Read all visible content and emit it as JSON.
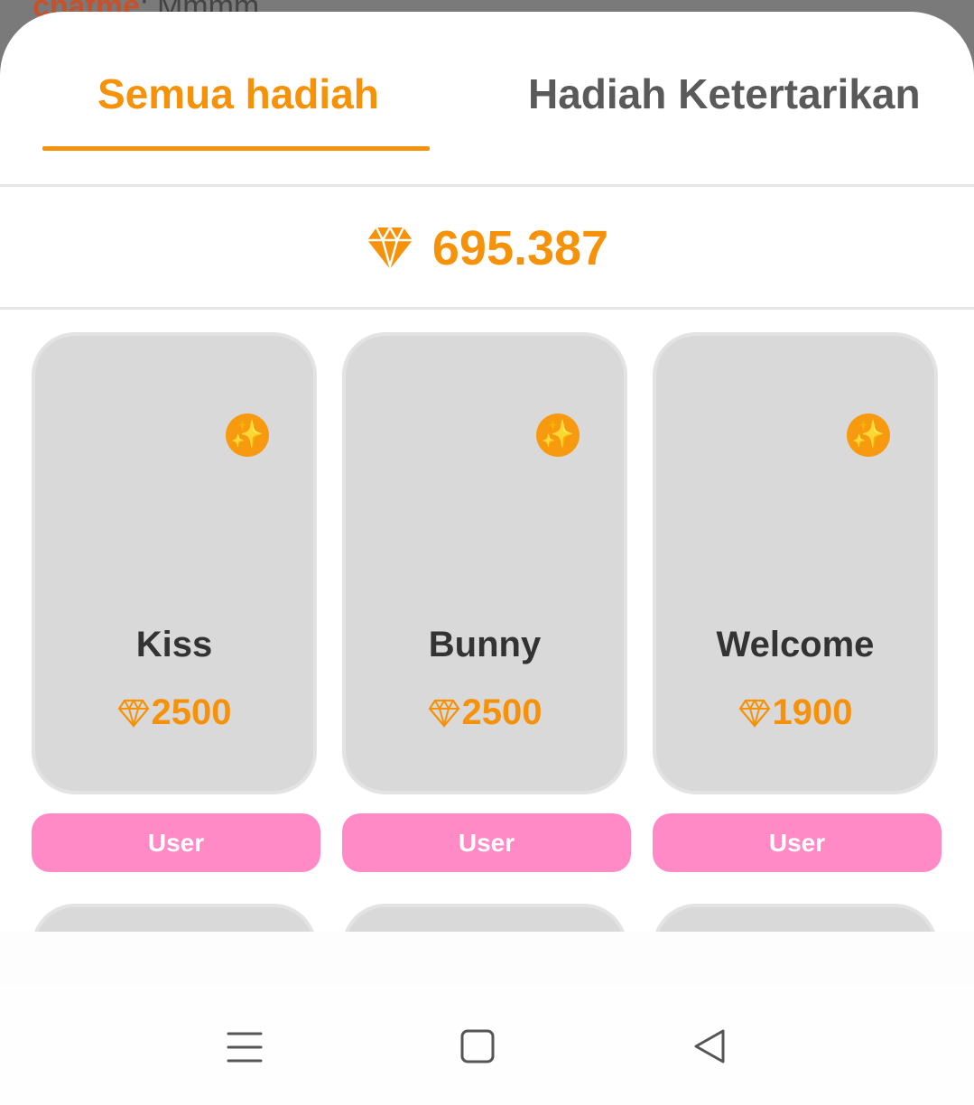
{
  "background_chat": {
    "user": "chatme",
    "separator": ": ",
    "message": "Mmmm"
  },
  "tabs": [
    {
      "label": "Semua hadiah",
      "active": true
    },
    {
      "label": "Hadiah Ketertarikan",
      "active": false
    }
  ],
  "balance": {
    "value": "695.387",
    "icon": "diamond-icon"
  },
  "gifts": [
    {
      "name": "Kiss",
      "price": "2500",
      "button": "User",
      "badge_icon": "sparkles-icon"
    },
    {
      "name": "Bunny",
      "price": "2500",
      "button": "User",
      "badge_icon": "sparkles-icon"
    },
    {
      "name": "Welcome",
      "price": "1900",
      "button": "User",
      "badge_icon": "sparkles-icon"
    }
  ],
  "nav": {
    "icons": [
      "menu-icon",
      "home-square-icon",
      "back-triangle-icon"
    ]
  },
  "colors": {
    "accent": "#f5920a",
    "card_bg": "#d9d9d9",
    "button_pink": "#ff8ac6",
    "tab_inactive": "#5a5a5a",
    "text_dark": "#333333"
  }
}
